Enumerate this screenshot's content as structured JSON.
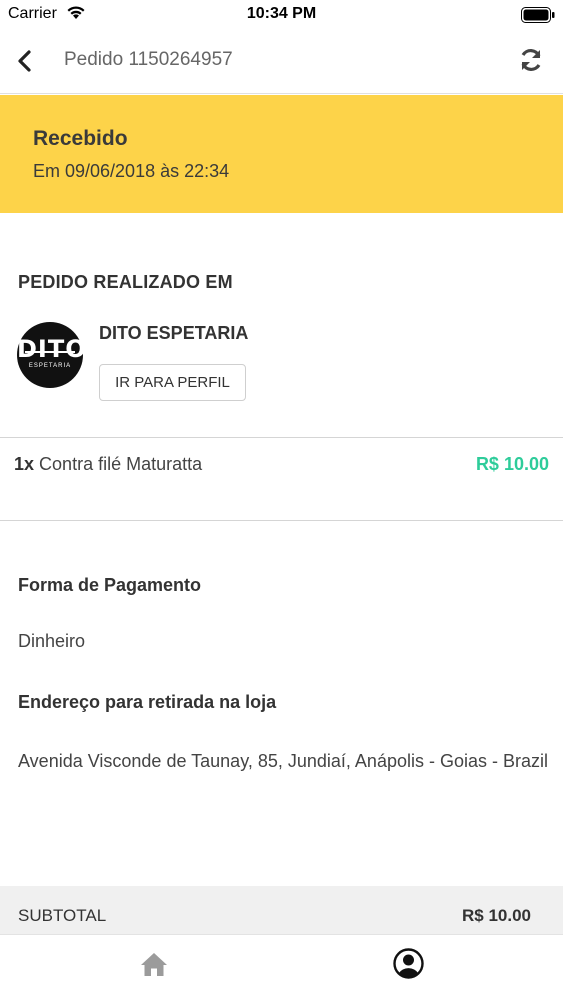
{
  "status_bar": {
    "carrier": "Carrier",
    "time": "10:34 PM"
  },
  "nav": {
    "title": "Pedido 1150264957",
    "icons": [
      "chevron-left-icon",
      "refresh-icon"
    ]
  },
  "order_status": {
    "title": "Recebido",
    "date": "Em 09/06/2018 às 22:34",
    "color": "#fdd349"
  },
  "store": {
    "section_label": "PEDIDO REALIZADO EM",
    "name": "DITO ESPETARIA",
    "profile_button": "IR PARA PERFIL",
    "logo_text": "DITO",
    "logo_subtext": "ESPETARIA"
  },
  "items": [
    {
      "qty": "1x",
      "name": "Contra filé Maturatta",
      "price": "R$ 10.00",
      "price_color": "#2ecc9a"
    }
  ],
  "payment": {
    "label": "Forma de Pagamento",
    "value": "Dinheiro"
  },
  "address": {
    "label": "Endereço para retirada na loja",
    "value": "Avenida Visconde de Taunay, 85, Jundiaí, Anápolis - Goias - Brazil"
  },
  "subtotal": {
    "label": "SUBTOTAL",
    "value": "R$ 10.00"
  },
  "tab_bar": {
    "icons": [
      "home-icon",
      "user-icon"
    ]
  }
}
